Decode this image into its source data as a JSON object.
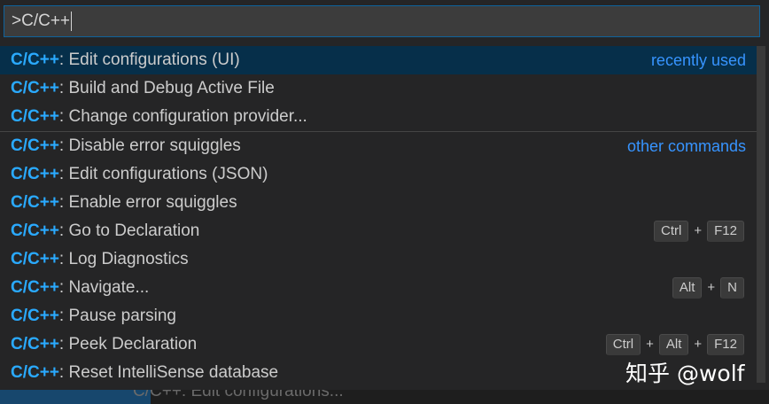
{
  "input": {
    "value": ">C/C++"
  },
  "items": [
    {
      "prefix": "C/C++",
      "label": ": Edit configurations (UI)",
      "group": "recently used",
      "keys": []
    },
    {
      "prefix": "C/C++",
      "label": ": Build and Debug Active File",
      "group": "",
      "keys": []
    },
    {
      "prefix": "C/C++",
      "label": ": Change configuration provider...",
      "group": "",
      "keys": []
    },
    {
      "prefix": "C/C++",
      "label": ": Disable error squiggles",
      "group": "other commands",
      "keys": []
    },
    {
      "prefix": "C/C++",
      "label": ": Edit configurations (JSON)",
      "group": "",
      "keys": []
    },
    {
      "prefix": "C/C++",
      "label": ": Enable error squiggles",
      "group": "",
      "keys": []
    },
    {
      "prefix": "C/C++",
      "label": ": Go to Declaration",
      "group": "",
      "keys": [
        "Ctrl",
        "F12"
      ]
    },
    {
      "prefix": "C/C++",
      "label": ": Log Diagnostics",
      "group": "",
      "keys": []
    },
    {
      "prefix": "C/C++",
      "label": ": Navigate...",
      "group": "",
      "keys": [
        "Alt",
        "N"
      ]
    },
    {
      "prefix": "C/C++",
      "label": ": Pause parsing",
      "group": "",
      "keys": []
    },
    {
      "prefix": "C/C++",
      "label": ": Peek Declaration",
      "group": "",
      "keys": [
        "Ctrl",
        "Alt",
        "F12"
      ]
    },
    {
      "prefix": "C/C++",
      "label": ": Reset IntelliSense database",
      "group": "",
      "keys": []
    }
  ],
  "key_separator": "+",
  "bottom_text": "C/C++: Edit configurations...",
  "watermark": "知乎 @wolf",
  "colors": {
    "prefix": "#2aaaff",
    "group": "#3794ff",
    "selected_bg": "#062f4a",
    "focus_border": "#0e639c"
  }
}
